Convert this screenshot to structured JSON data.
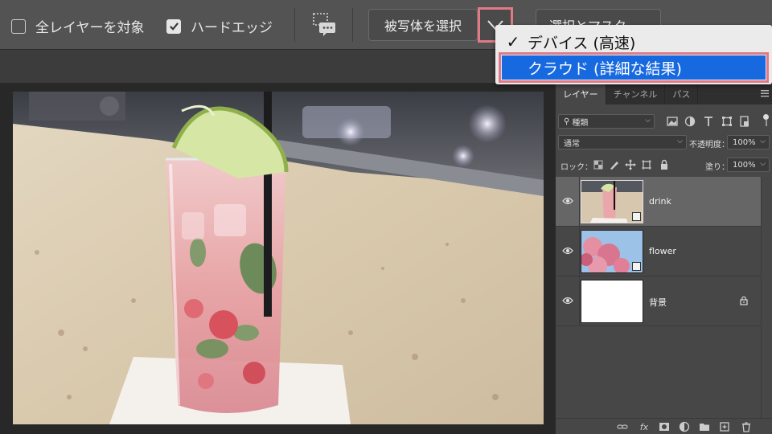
{
  "options_bar": {
    "all_layers_label": "全レイヤーを対象",
    "all_layers_checked": false,
    "hard_edge_label": "ハードエッジ",
    "hard_edge_checked": true,
    "select_subject_label": "被写体を選択",
    "select_mask_label": "選択とマスク..."
  },
  "dropdown": {
    "items": [
      {
        "label": "デバイス (高速)",
        "checked": true,
        "highlighted": false
      },
      {
        "label": "クラウド (詳細な結果)",
        "checked": false,
        "highlighted": true
      }
    ]
  },
  "layers_panel": {
    "tabs": [
      "レイヤー",
      "チャンネル",
      "パス"
    ],
    "active_tab": "レイヤー",
    "filter_kind": "種類",
    "blend_mode": "通常",
    "opacity_label": "不透明度：",
    "opacity_value": "100%",
    "lock_label": "ロック：",
    "fill_label": "塗り：",
    "fill_value": "100%",
    "layers": [
      {
        "name": "drink",
        "selected": true,
        "smart_object": true,
        "locked": false
      },
      {
        "name": "flower",
        "selected": false,
        "smart_object": true,
        "locked": false
      },
      {
        "name": "背景",
        "selected": false,
        "smart_object": false,
        "locked": true
      }
    ],
    "bottom_fx": "fx"
  },
  "colors": {
    "highlight": "#1769e0",
    "annotation": "#e07a86",
    "panel_bg": "#474747",
    "options_bg": "#535353"
  }
}
